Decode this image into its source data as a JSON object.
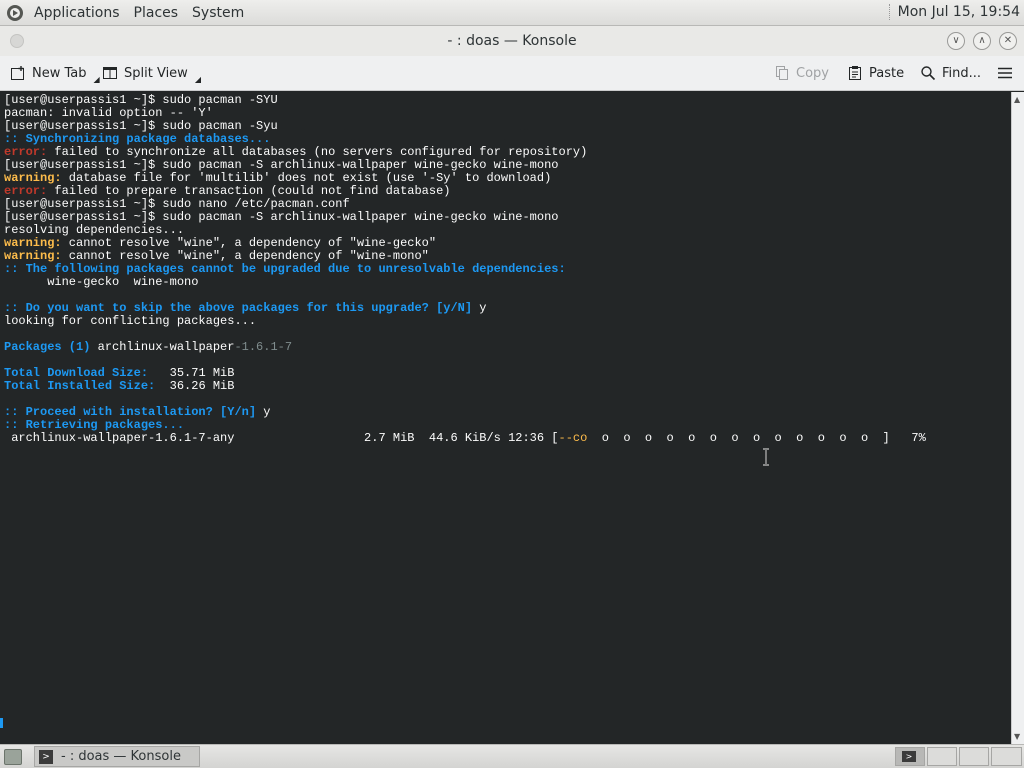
{
  "top_panel": {
    "menus": [
      "Applications",
      "Places",
      "System"
    ],
    "clock": "Mon Jul 15, 19:54"
  },
  "window": {
    "title": "- : doas — Konsole"
  },
  "toolbar": {
    "new_tab": "New Tab",
    "split_view": "Split View",
    "copy": "Copy",
    "paste": "Paste",
    "find": "Find..."
  },
  "terminal": {
    "lines": [
      [
        {
          "t": "[user@userpassis1 ~]$ sudo pacman -SYU"
        }
      ],
      [
        {
          "t": "pacman: invalid option -- 'Y'"
        }
      ],
      [
        {
          "t": "[user@userpassis1 ~]$ sudo pacman -Syu"
        }
      ],
      [
        {
          "t": ":: Synchronizing package databases...",
          "c": "blue"
        }
      ],
      [
        {
          "t": "error:",
          "c": "red"
        },
        {
          "t": " failed to synchronize all databases (no servers configured for repository)"
        }
      ],
      [
        {
          "t": "[user@userpassis1 ~]$ sudo pacman -S archlinux-wallpaper wine-gecko wine-mono"
        }
      ],
      [
        {
          "t": "warning:",
          "c": "yellow"
        },
        {
          "t": " database file for 'multilib' does not exist (use '-Sy' to download)"
        }
      ],
      [
        {
          "t": "error:",
          "c": "red"
        },
        {
          "t": " failed to prepare transaction (could not find database)"
        }
      ],
      [
        {
          "t": "[user@userpassis1 ~]$ sudo nano /etc/pacman.conf"
        }
      ],
      [
        {
          "t": "[user@userpassis1 ~]$ sudo pacman -S archlinux-wallpaper wine-gecko wine-mono"
        }
      ],
      [
        {
          "t": "resolving dependencies..."
        }
      ],
      [
        {
          "t": "warning:",
          "c": "yellow"
        },
        {
          "t": " cannot resolve \"wine\", a dependency of \"wine-gecko\""
        }
      ],
      [
        {
          "t": "warning:",
          "c": "yellow"
        },
        {
          "t": " cannot resolve \"wine\", a dependency of \"wine-mono\""
        }
      ],
      [
        {
          "t": ":: The following packages cannot be upgraded due to unresolvable dependencies:",
          "c": "blue"
        }
      ],
      [
        {
          "t": "      wine-gecko  wine-mono"
        }
      ],
      [
        {
          "t": ""
        }
      ],
      [
        {
          "t": ":: Do you want to skip the above packages for this upgrade? [y/N]",
          "c": "blue"
        },
        {
          "t": " y"
        }
      ],
      [
        {
          "t": "looking for conflicting packages..."
        }
      ],
      [
        {
          "t": ""
        }
      ],
      [
        {
          "t": "Packages (1)",
          "c": "blue"
        },
        {
          "t": " archlinux-wallpaper"
        },
        {
          "t": "-1.6.1-7",
          "c": "dim"
        }
      ],
      [
        {
          "t": ""
        }
      ],
      [
        {
          "t": "Total Download Size:",
          "c": "blue"
        },
        {
          "t": "   35.71 MiB"
        }
      ],
      [
        {
          "t": "Total Installed Size:",
          "c": "blue"
        },
        {
          "t": "  36.26 MiB"
        }
      ],
      [
        {
          "t": ""
        }
      ],
      [
        {
          "t": ":: Proceed with installation? [Y/n]",
          "c": "blue"
        },
        {
          "t": " y"
        }
      ],
      [
        {
          "t": ":: Retrieving packages...",
          "c": "blue"
        }
      ],
      [
        {
          "t": " archlinux-wallpaper-1.6.1-7-any                  2.7 MiB  44.6 KiB/s 12:36 ["
        },
        {
          "t": "--co",
          "c": "bar"
        },
        {
          "t": "  o  o  o  o  o  o  o  o  o  o  o  o  o  ]   7%"
        }
      ]
    ]
  },
  "taskbar": {
    "task_label": "- : doas — Konsole"
  }
}
